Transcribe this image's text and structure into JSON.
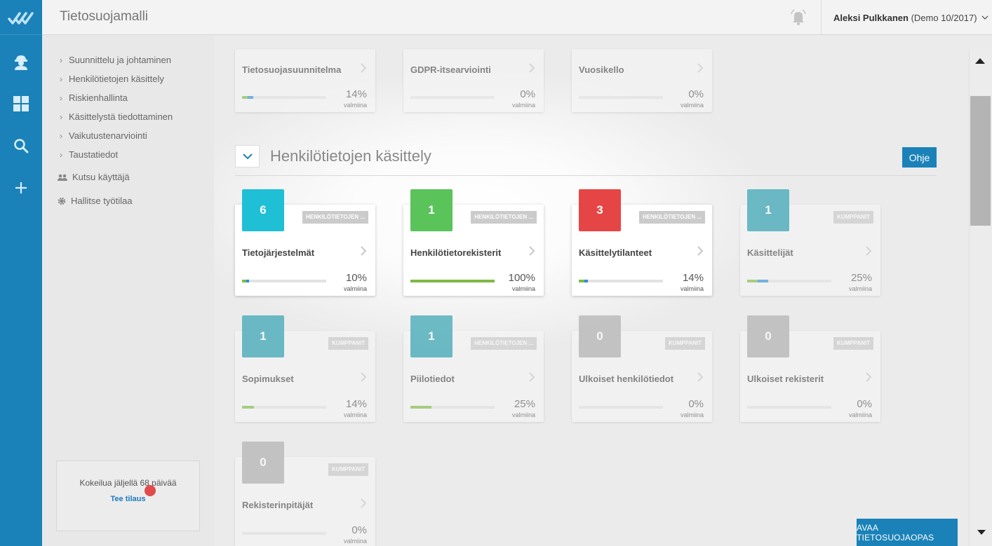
{
  "app": {
    "title": "Tietosuojamalli"
  },
  "user": {
    "name": "Aleksi Pulkkanen",
    "org": "(Demo 10/2017)"
  },
  "colors": {
    "primary": "#1a82b8",
    "teal": "#1fbfd6",
    "dark_teal": "#1b9aaa",
    "green": "#5ac35a",
    "red": "#e64545",
    "gray": "#a9a9a9",
    "bar_green": "#7dbb43",
    "bar_blue": "#2d8fd6"
  },
  "rail_icons": [
    "worker-icon",
    "grid-icon",
    "search-icon",
    "plus-icon"
  ],
  "nav": {
    "items": [
      {
        "label": "Suunnittelu ja johtaminen"
      },
      {
        "label": "Henkilötietojen käsittely"
      },
      {
        "label": "Riskienhallinta"
      },
      {
        "label": "Käsittelystä tiedottaminen"
      },
      {
        "label": "Vaikutustenarviointi"
      },
      {
        "label": "Taustatiedot"
      }
    ],
    "invite_label": "Kutsu käyttäjä",
    "manage_label": "Hallitse työtilaa"
  },
  "trial": {
    "text": "Kokeilua jäljellä 68 päivää",
    "link": "Tee tilaus"
  },
  "top_cards": [
    {
      "name": "Tietosuojasuunnitelma",
      "percent": "14%",
      "done_label": "valmiina",
      "progress_green": 0.14,
      "progress_blue": 0.14
    },
    {
      "name": "GDPR-itsearviointi",
      "percent": "0%",
      "done_label": "valmiina",
      "progress_green": 0,
      "progress_blue": 0
    },
    {
      "name": "Vuosikello",
      "percent": "0%",
      "done_label": "valmiina",
      "progress_green": 0,
      "progress_blue": 0
    }
  ],
  "section": {
    "title": "Henkilötietojen käsittely",
    "help_label": "Ohje"
  },
  "cards": [
    {
      "count": "6",
      "badge_color": "#1fbfd6",
      "tag": "HENKILÖTIETOJEN ...",
      "name": "Tietojärjestelmät",
      "percent": "10%",
      "done_label": "valmiina",
      "progress_green": 0.1,
      "progress_blue": 0.07,
      "lit": true
    },
    {
      "count": "1",
      "badge_color": "#5ac35a",
      "tag": "HENKILÖTIETOJEN ...",
      "name": "Henkilötietorekisterit",
      "percent": "100%",
      "done_label": "valmiina",
      "progress_green": 1.0,
      "progress_blue": 0,
      "lit": true
    },
    {
      "count": "3",
      "badge_color": "#e64545",
      "tag": "HENKILÖTIETOJEN ...",
      "name": "Käsittelytilanteet",
      "percent": "14%",
      "done_label": "valmiina",
      "progress_green": 0.14,
      "progress_blue": 0.08,
      "lit": true
    },
    {
      "count": "1",
      "badge_color": "#1b9aaa",
      "tag": "KUMPPANIT",
      "name": "Käsittelijät",
      "percent": "25%",
      "done_label": "valmiina",
      "progress_green": 0.25,
      "progress_blue": 0.25,
      "lit": false
    },
    {
      "count": "1",
      "badge_color": "#1b9aaa",
      "tag": "KUMPPANIT",
      "name": "Sopimukset",
      "percent": "14%",
      "done_label": "valmiina",
      "progress_green": 0.14,
      "progress_blue": 0,
      "lit": false
    },
    {
      "count": "1",
      "badge_color": "#1b9aaa",
      "tag": "HENKILÖTIETOJEN ...",
      "name": "Piilotiedot",
      "percent": "25%",
      "done_label": "valmiina",
      "progress_green": 0.25,
      "progress_blue": 0,
      "lit": false
    },
    {
      "count": "0",
      "badge_color": "#a9a9a9",
      "tag": "KUMPPANIT",
      "name": "Ulkoiset henkilötiedot",
      "percent": "0%",
      "done_label": "valmiina",
      "progress_green": 0,
      "progress_blue": 0,
      "lit": false
    },
    {
      "count": "0",
      "badge_color": "#a9a9a9",
      "tag": "KUMPPANIT",
      "name": "Ulkoiset rekisterit",
      "percent": "0%",
      "done_label": "valmiina",
      "progress_green": 0,
      "progress_blue": 0,
      "lit": false
    },
    {
      "count": "0",
      "badge_color": "#a9a9a9",
      "tag": "KUMPPANIT",
      "name": "Rekisterinpitäjät",
      "percent": "0%",
      "done_label": "valmiina",
      "progress_green": 0,
      "progress_blue": 0,
      "lit": false
    }
  ],
  "guide_button": "AVAA TIETOSUOJAOPAS"
}
